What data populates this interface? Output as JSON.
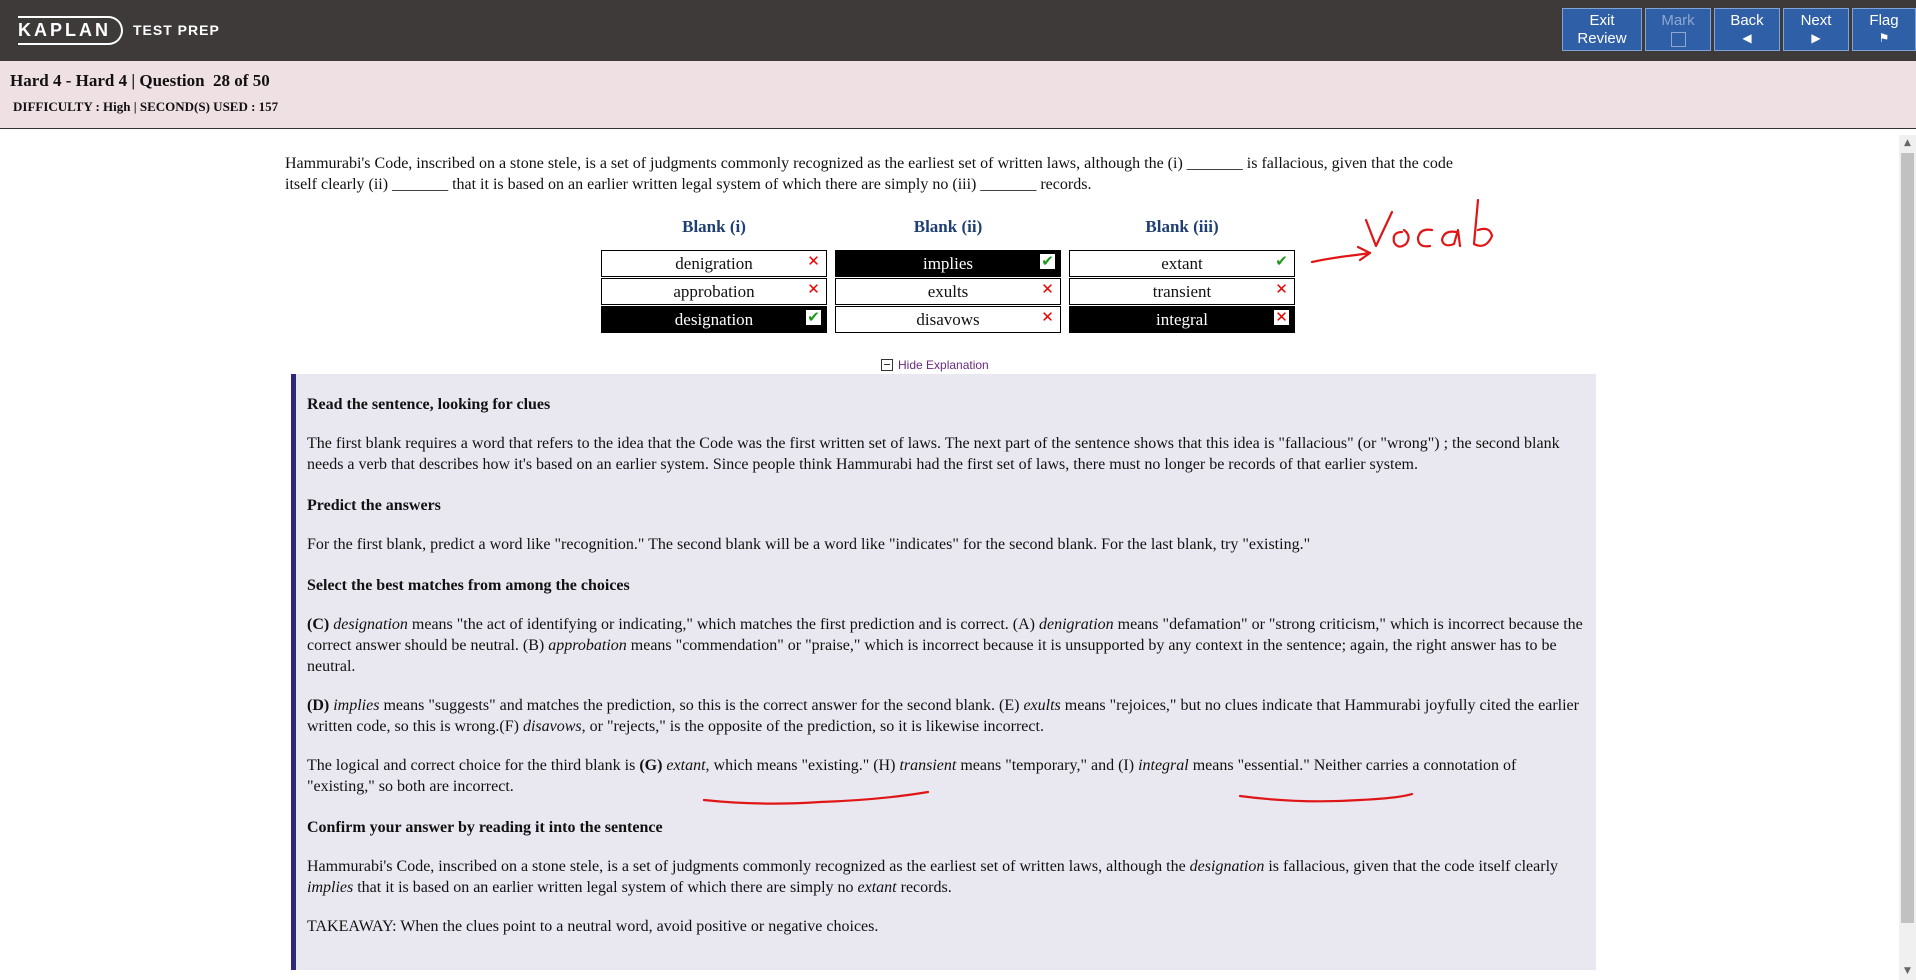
{
  "logo": {
    "main": "KAPLAN",
    "sub": "TEST PREP"
  },
  "nav": {
    "exit_line1": "Exit",
    "exit_line2": "Review",
    "mark": "Mark",
    "back": "Back",
    "back_arrow": "◀",
    "next": "Next",
    "next_arrow": "▶",
    "flag": "Flag",
    "flag_icon": "⚑"
  },
  "header": {
    "title": "Hard 4 - Hard 4 | Question  28 of 50",
    "meta": "DIFFICULTY : High | SECOND(S) USED : 157"
  },
  "question": {
    "line1": "Hammurabi's Code, inscribed on a stone stele, is a set of judgments commonly recognized as the earliest set of written laws, although the (i) _______ is fallacious, given that the code",
    "line2": "itself clearly (ii) _______ that it is based on an earlier written legal system of which there are simply no (iii) _______ records."
  },
  "blanks": [
    {
      "header": "Blank (i)",
      "options": [
        {
          "text": "denigration",
          "selected": false,
          "mark": "x"
        },
        {
          "text": "approbation",
          "selected": false,
          "mark": "x"
        },
        {
          "text": "designation",
          "selected": true,
          "mark": "ok"
        }
      ]
    },
    {
      "header": "Blank (ii)",
      "options": [
        {
          "text": "implies",
          "selected": true,
          "mark": "ok"
        },
        {
          "text": "exults",
          "selected": false,
          "mark": "x"
        },
        {
          "text": "disavows",
          "selected": false,
          "mark": "x"
        }
      ]
    },
    {
      "header": "Blank (iii)",
      "options": [
        {
          "text": "extant",
          "selected": false,
          "mark": "ok"
        },
        {
          "text": "transient",
          "selected": false,
          "mark": "x"
        },
        {
          "text": "integral",
          "selected": true,
          "mark": "x"
        }
      ]
    }
  ],
  "hide_explanation": "Hide Explanation",
  "explanation": {
    "h1": "Read the sentence, looking for clues",
    "p1": "The first blank requires a word that refers to the idea that the Code was the first written set of laws. The next part of the sentence shows that this idea is \"fallacious\" (or \"wrong\") ; the second blank needs a verb that describes how it's based on an earlier system. Since people think Hammurabi had the first set of laws, there must no longer be records of that earlier system.",
    "h2": "Predict the answers",
    "p2": "For the first blank, predict a word like \"recognition.\" The second blank will be a word like \"indicates\" for the second blank. For the last blank, try \"existing.\"",
    "h3": "Select the best matches from among the choices",
    "p3": {
      "a": "(C)",
      "b": "designation",
      "c": " means \"the act of identifying or indicating,\" which matches the first prediction and is correct. (A) ",
      "d": "denigration",
      "e": " means \"defamation\" or \"strong criticism,\" which is incorrect because the correct answer should be neutral. (B) ",
      "f": "approbation",
      "g": " means \"commendation\" or \"praise,\" which is incorrect because it is unsupported by any context in the sentence; again, the right answer has to be neutral."
    },
    "p4": {
      "a": "(D)",
      "b": "implies",
      "c": " means \"suggests\" and matches the prediction, so this is the correct answer for the second blank. (E) ",
      "d": "exults",
      "e": " means \"rejoices,\" but no clues indicate that Hammurabi joyfully cited the earlier written code, so this is wrong.(F) ",
      "f": "disavows",
      "g": ", or \"rejects,\" is the opposite of the prediction, so it is likewise incorrect."
    },
    "p5": {
      "a": "The logical and correct choice for the third blank is ",
      "b": "(G)",
      "c": "extant",
      "d": ", which means \"existing.\" (H) ",
      "e": "transient",
      "f": " means \"temporary,\" and (I) ",
      "g": "integral",
      "h": " means \"essential.\" Neither carries a connotation of \"existing,\" so both are incorrect."
    },
    "h4": "Confirm your answer by reading it into the sentence",
    "p6": {
      "a": "Hammurabi's Code, inscribed on a stone stele, is a set of judgments commonly recognized as the earliest set of written laws, although the ",
      "b": "designation",
      "c": " is fallacious, given that the code itself clearly ",
      "d": "implies",
      "e": " that it is based on an earlier written legal system of which there are simply no ",
      "f": "extant",
      "g": " records."
    },
    "p7": "TAKEAWAY: When the clues point to a neutral word, avoid positive or negative choices."
  },
  "annotation": {
    "handwritten_text": "Vocab",
    "ink_color": "#e01515"
  },
  "colors": {
    "topbar": "#3d3a39",
    "button": "#2f5fa7",
    "header_bg": "#efe0e4",
    "explain_bg": "#e9e8f0",
    "accent": "#2e2a7a"
  }
}
